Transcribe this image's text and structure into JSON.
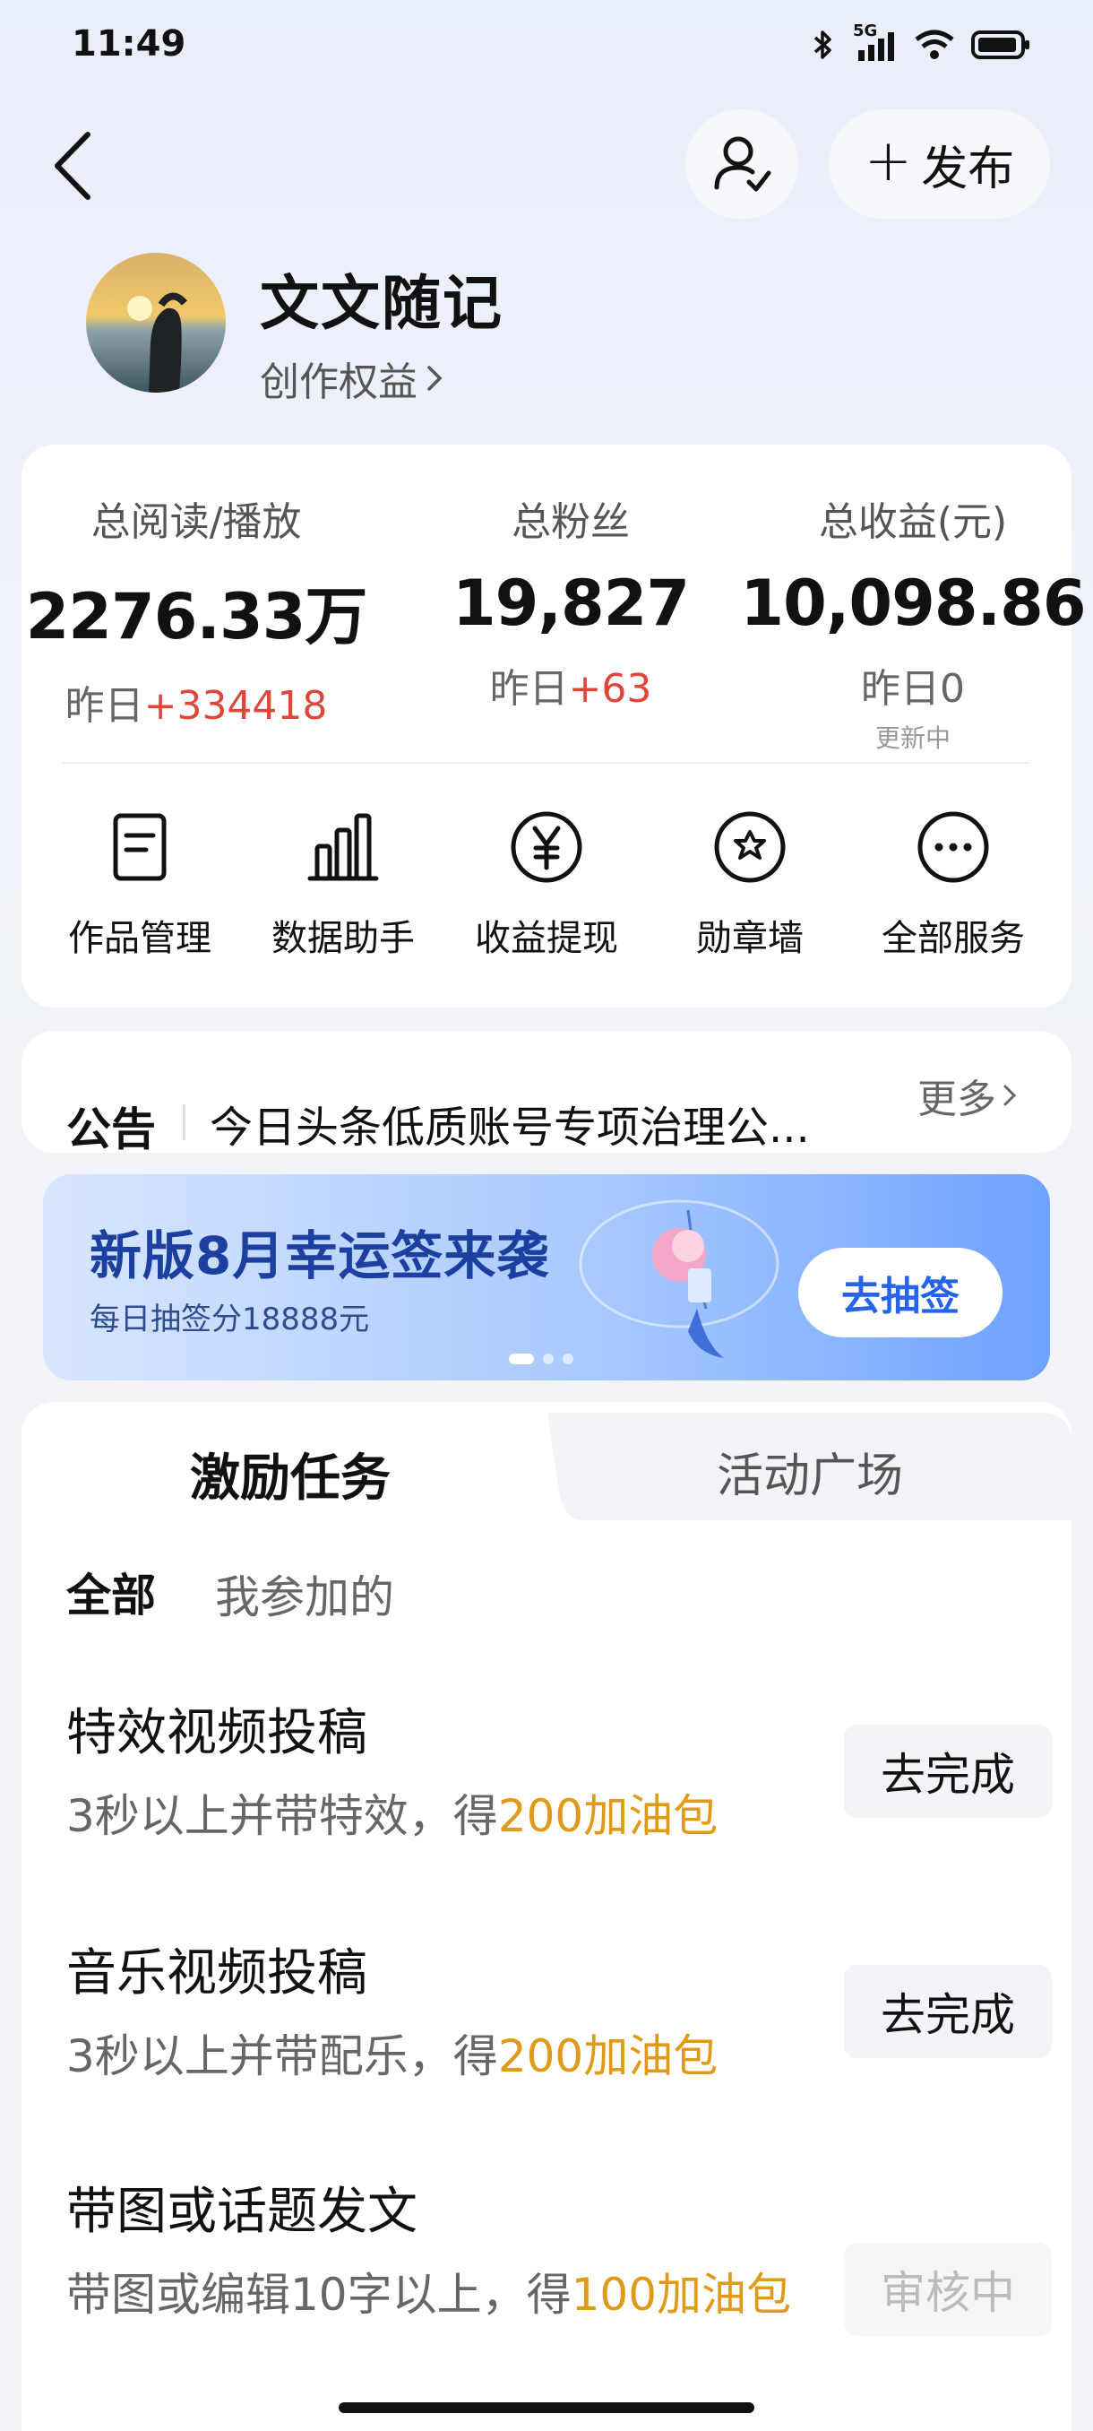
{
  "status_bar": {
    "time": "11:49",
    "network": "5G"
  },
  "header": {
    "publish_label": "发布"
  },
  "profile": {
    "name": "文文随记",
    "link_label": "创作权益"
  },
  "stats": [
    {
      "label": "总阅读/播放",
      "value": "2276.33万",
      "delta_prefix": "昨日",
      "delta": "+334418"
    },
    {
      "label": "总粉丝",
      "value": "19,827",
      "delta_prefix": "昨日",
      "delta": "+63"
    },
    {
      "label": "总收益(元)",
      "value": "10,098.86",
      "delta_prefix": "昨日",
      "delta": "0",
      "sub": "更新中"
    }
  ],
  "services": [
    {
      "label": "作品管理",
      "icon": "document-icon"
    },
    {
      "label": "数据助手",
      "icon": "bar-chart-icon"
    },
    {
      "label": "收益提现",
      "icon": "yen-icon"
    },
    {
      "label": "勋章墙",
      "icon": "medal-icon"
    },
    {
      "label": "全部服务",
      "icon": "more-icon"
    }
  ],
  "notice": {
    "title": "公告",
    "text": "今日头条低质账号专项治理公...",
    "more_label": "更多"
  },
  "banner": {
    "title": "新版8月幸运签来袭",
    "subtitle": "每日抽签分18888元",
    "button_label": "去抽签"
  },
  "tabs": [
    {
      "label": "激励任务",
      "active": true
    },
    {
      "label": "活动广场",
      "active": false
    }
  ],
  "filters": [
    {
      "label": "全部",
      "active": true
    },
    {
      "label": "我参加的",
      "active": false
    }
  ],
  "tasks": [
    {
      "title": "特效视频投稿",
      "desc_prefix": "3秒以上并带特效，得",
      "reward": "200加油包",
      "button": "去完成",
      "status": "open"
    },
    {
      "title": "音乐视频投稿",
      "desc_prefix": "3秒以上并带配乐，得",
      "reward": "200加油包",
      "button": "去完成",
      "status": "open"
    },
    {
      "title": "带图或话题发文",
      "desc_prefix": "带图或编辑10字以上，得",
      "reward": "100加油包",
      "button": "审核中",
      "status": "pending"
    }
  ],
  "colors": {
    "accent_red": "#e0453a",
    "reward_orange": "#e19a17",
    "brand_blue": "#2563eb"
  }
}
